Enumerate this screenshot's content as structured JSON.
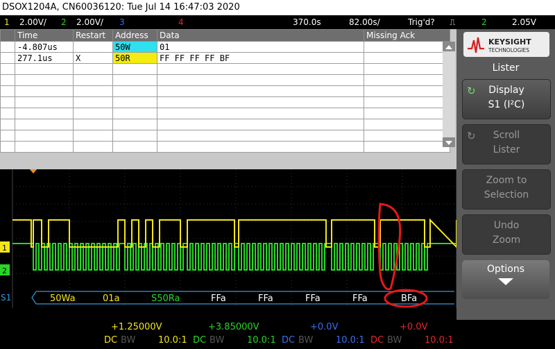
{
  "title_bar": {
    "text": "DSOX1204A, CN60036120: Tue Jul 14 16:47:03 2020"
  },
  "status_bar": {
    "ch1_num": "1",
    "ch1_scale": "2.00V/",
    "ch2_num": "2",
    "ch2_scale": "2.00V/",
    "ch3_num": "3",
    "ch4_num": "4",
    "timebase": "370.0s",
    "delay": "82.00s/",
    "trigger_state": "Trig'd?",
    "trigger_ch": "2",
    "trigger_level": "2.05V"
  },
  "lister": {
    "columns": [
      "Time",
      "Restart",
      "Address",
      "Data",
      "Missing Ack"
    ],
    "rows": [
      {
        "time": "-4.807us",
        "restart": "",
        "address": "50W",
        "data": "01",
        "missing_ack": ""
      },
      {
        "time": "277.1us",
        "restart": "X",
        "address": "50R",
        "data": "FF  FF  FF  FF  BF",
        "missing_ack": ""
      },
      {
        "time": "",
        "restart": "",
        "address": "",
        "data": "",
        "missing_ack": ""
      },
      {
        "time": "",
        "restart": "",
        "address": "",
        "data": "",
        "missing_ack": ""
      },
      {
        "time": "",
        "restart": "",
        "address": "",
        "data": "",
        "missing_ack": ""
      },
      {
        "time": "",
        "restart": "",
        "address": "",
        "data": "",
        "missing_ack": ""
      },
      {
        "time": "",
        "restart": "",
        "address": "",
        "data": "",
        "missing_ack": ""
      },
      {
        "time": "",
        "restart": "",
        "address": "",
        "data": "",
        "missing_ack": ""
      },
      {
        "time": "",
        "restart": "",
        "address": "",
        "data": "",
        "missing_ack": ""
      },
      {
        "time": "",
        "restart": "",
        "address": "",
        "data": "",
        "missing_ack": ""
      }
    ]
  },
  "decode_bus": {
    "label": "S1",
    "packets": [
      "50Wa",
      "01a",
      "S50Ra",
      "FFa",
      "FFa",
      "FFa",
      "FFa",
      "BFa"
    ]
  },
  "channel_markers": {
    "ch1": "1",
    "ch2": "2"
  },
  "right_panel": {
    "brand": "KEYSIGHT",
    "brand_sub": "TECHNOLOGIES",
    "menu_title": "Lister",
    "display_label": "Display",
    "display_value": "S1 (I²C)",
    "scroll_label": "Scroll",
    "scroll_label2": "Lister",
    "zoom_label": "Zoom to",
    "zoom_label2": "Selection",
    "undo_label": "Undo",
    "undo_label2": "Zoom",
    "options_label": "Options"
  },
  "bottom_bar": {
    "ch1_offset": "+1.25000V",
    "ch2_offset": "+3.85000V",
    "ch3_offset": "+0.0V",
    "ch4_offset": "+0.0V",
    "coupling": "DC",
    "bw": "BW",
    "probe": "10.0:1"
  },
  "colors": {
    "ch1": "#f5e61a",
    "ch2": "#29d627",
    "ch3": "#3a6ff0",
    "ch4": "#e8262b",
    "decode": "#2f9be0",
    "annotation": "#e81818"
  }
}
